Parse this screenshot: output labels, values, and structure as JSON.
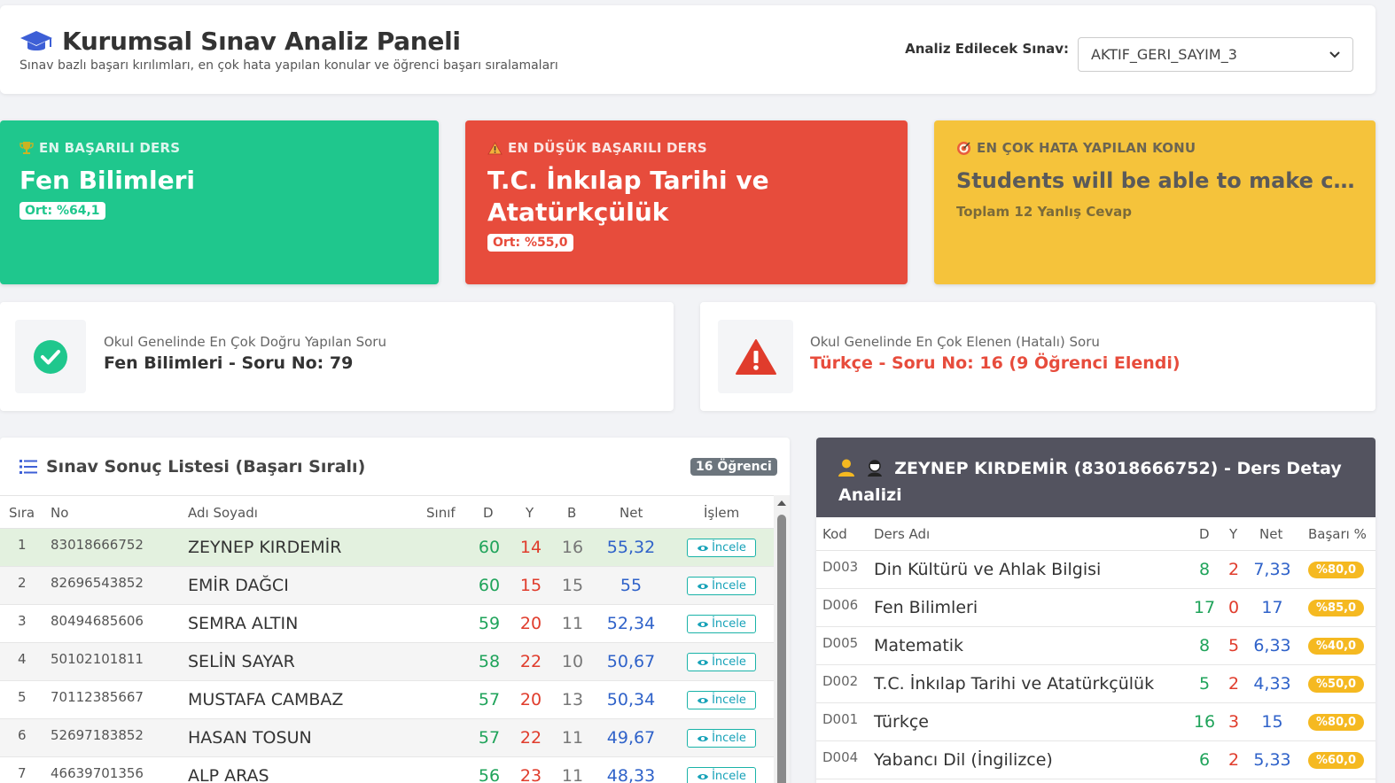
{
  "header": {
    "title": "Kurumsal Sınav Analiz Paneli",
    "subtitle": "Sınav bazlı başarı kırılımları, en çok hata yapılan konular ve öğrenci başarı sıralamaları",
    "select_label": "Analiz Edilecek Sınav:",
    "select_value": "AKTIF_GERI_SAYIM_3"
  },
  "cards": {
    "best": {
      "label": "EN BAŞARILI DERS",
      "title": "Fen Bilimleri",
      "pill": "Ort: %64,1",
      "icon": "trophy-icon"
    },
    "worst": {
      "label": "EN DÜŞÜK BAŞARILI DERS",
      "title": "T.C. İnkılap Tarihi ve Atatürkçülük",
      "pill": "Ort: %55,0",
      "icon": "warning-icon"
    },
    "topic": {
      "label": "EN ÇOK HATA YAPILAN KONU",
      "title": "Students will be able to make compa...",
      "sub": "Toplam 12 Yanlış Cevap",
      "icon": "target-icon"
    }
  },
  "questions": {
    "best": {
      "label": "Okul Genelinde En Çok Doğru Yapılan Soru",
      "value": "Fen Bilimleri - Soru No: 79"
    },
    "worst": {
      "label": "Okul Genelinde En Çok Elenen (Hatalı) Soru",
      "value": "Türkçe - Soru No: 16 (9 Öğrenci Elendi)"
    }
  },
  "list": {
    "title": "Sınav Sonuç Listesi (Başarı Sıralı)",
    "count": "16 Öğrenci",
    "columns": {
      "sira": "Sıra",
      "no": "No",
      "name": "Adı Soyadı",
      "sinif": "Sınıf",
      "d": "D",
      "y": "Y",
      "b": "B",
      "net": "Net",
      "islem": "İşlem"
    },
    "button_label": "İncele",
    "rows": [
      {
        "sira": "1",
        "no": "83018666752",
        "name": "ZEYNEP KIRDEMİR",
        "d": "60",
        "y": "14",
        "b": "16",
        "net": "55,32"
      },
      {
        "sira": "2",
        "no": "82696543852",
        "name": "EMİR DAĞCI",
        "d": "60",
        "y": "15",
        "b": "15",
        "net": "55"
      },
      {
        "sira": "3",
        "no": "80494685606",
        "name": "SEMRA ALTIN",
        "d": "59",
        "y": "20",
        "b": "11",
        "net": "52,34"
      },
      {
        "sira": "4",
        "no": "50102101811",
        "name": "SELİN SAYAR",
        "d": "58",
        "y": "22",
        "b": "10",
        "net": "50,67"
      },
      {
        "sira": "5",
        "no": "70112385667",
        "name": "MUSTAFA CAMBAZ",
        "d": "57",
        "y": "20",
        "b": "13",
        "net": "50,34"
      },
      {
        "sira": "6",
        "no": "52697183852",
        "name": "HASAN TOSUN",
        "d": "57",
        "y": "22",
        "b": "11",
        "net": "49,67"
      },
      {
        "sira": "7",
        "no": "46639701356",
        "name": "ALP ARAS",
        "d": "56",
        "y": "23",
        "b": "11",
        "net": "48,33"
      }
    ]
  },
  "detail": {
    "title": "ZEYNEP KIRDEMİR (83018666752) - Ders Detay Analizi",
    "columns": {
      "kod": "Kod",
      "name": "Ders Adı",
      "d": "D",
      "y": "Y",
      "net": "Net",
      "basari": "Başarı %"
    },
    "rows": [
      {
        "kod": "D003",
        "name": "Din Kültürü ve Ahlak Bilgisi",
        "d": "8",
        "y": "2",
        "net": "7,33",
        "basari": "%80,0"
      },
      {
        "kod": "D006",
        "name": "Fen Bilimleri",
        "d": "17",
        "y": "0",
        "net": "17",
        "basari": "%85,0"
      },
      {
        "kod": "D005",
        "name": "Matematik",
        "d": "8",
        "y": "5",
        "net": "6,33",
        "basari": "%40,0"
      },
      {
        "kod": "D002",
        "name": "T.C. İnkılap Tarihi ve Atatürkçülük",
        "d": "5",
        "y": "2",
        "net": "4,33",
        "basari": "%50,0"
      },
      {
        "kod": "D001",
        "name": "Türkçe",
        "d": "16",
        "y": "3",
        "net": "15",
        "basari": "%80,0"
      },
      {
        "kod": "D004",
        "name": "Yabancı Dil (İngilizce)",
        "d": "6",
        "y": "2",
        "net": "5,33",
        "basari": "%60,0"
      }
    ]
  },
  "colors": {
    "green": "#1fc78d",
    "red": "#e74c3c",
    "yellow": "#f5c33b",
    "dark": "#53535f"
  }
}
